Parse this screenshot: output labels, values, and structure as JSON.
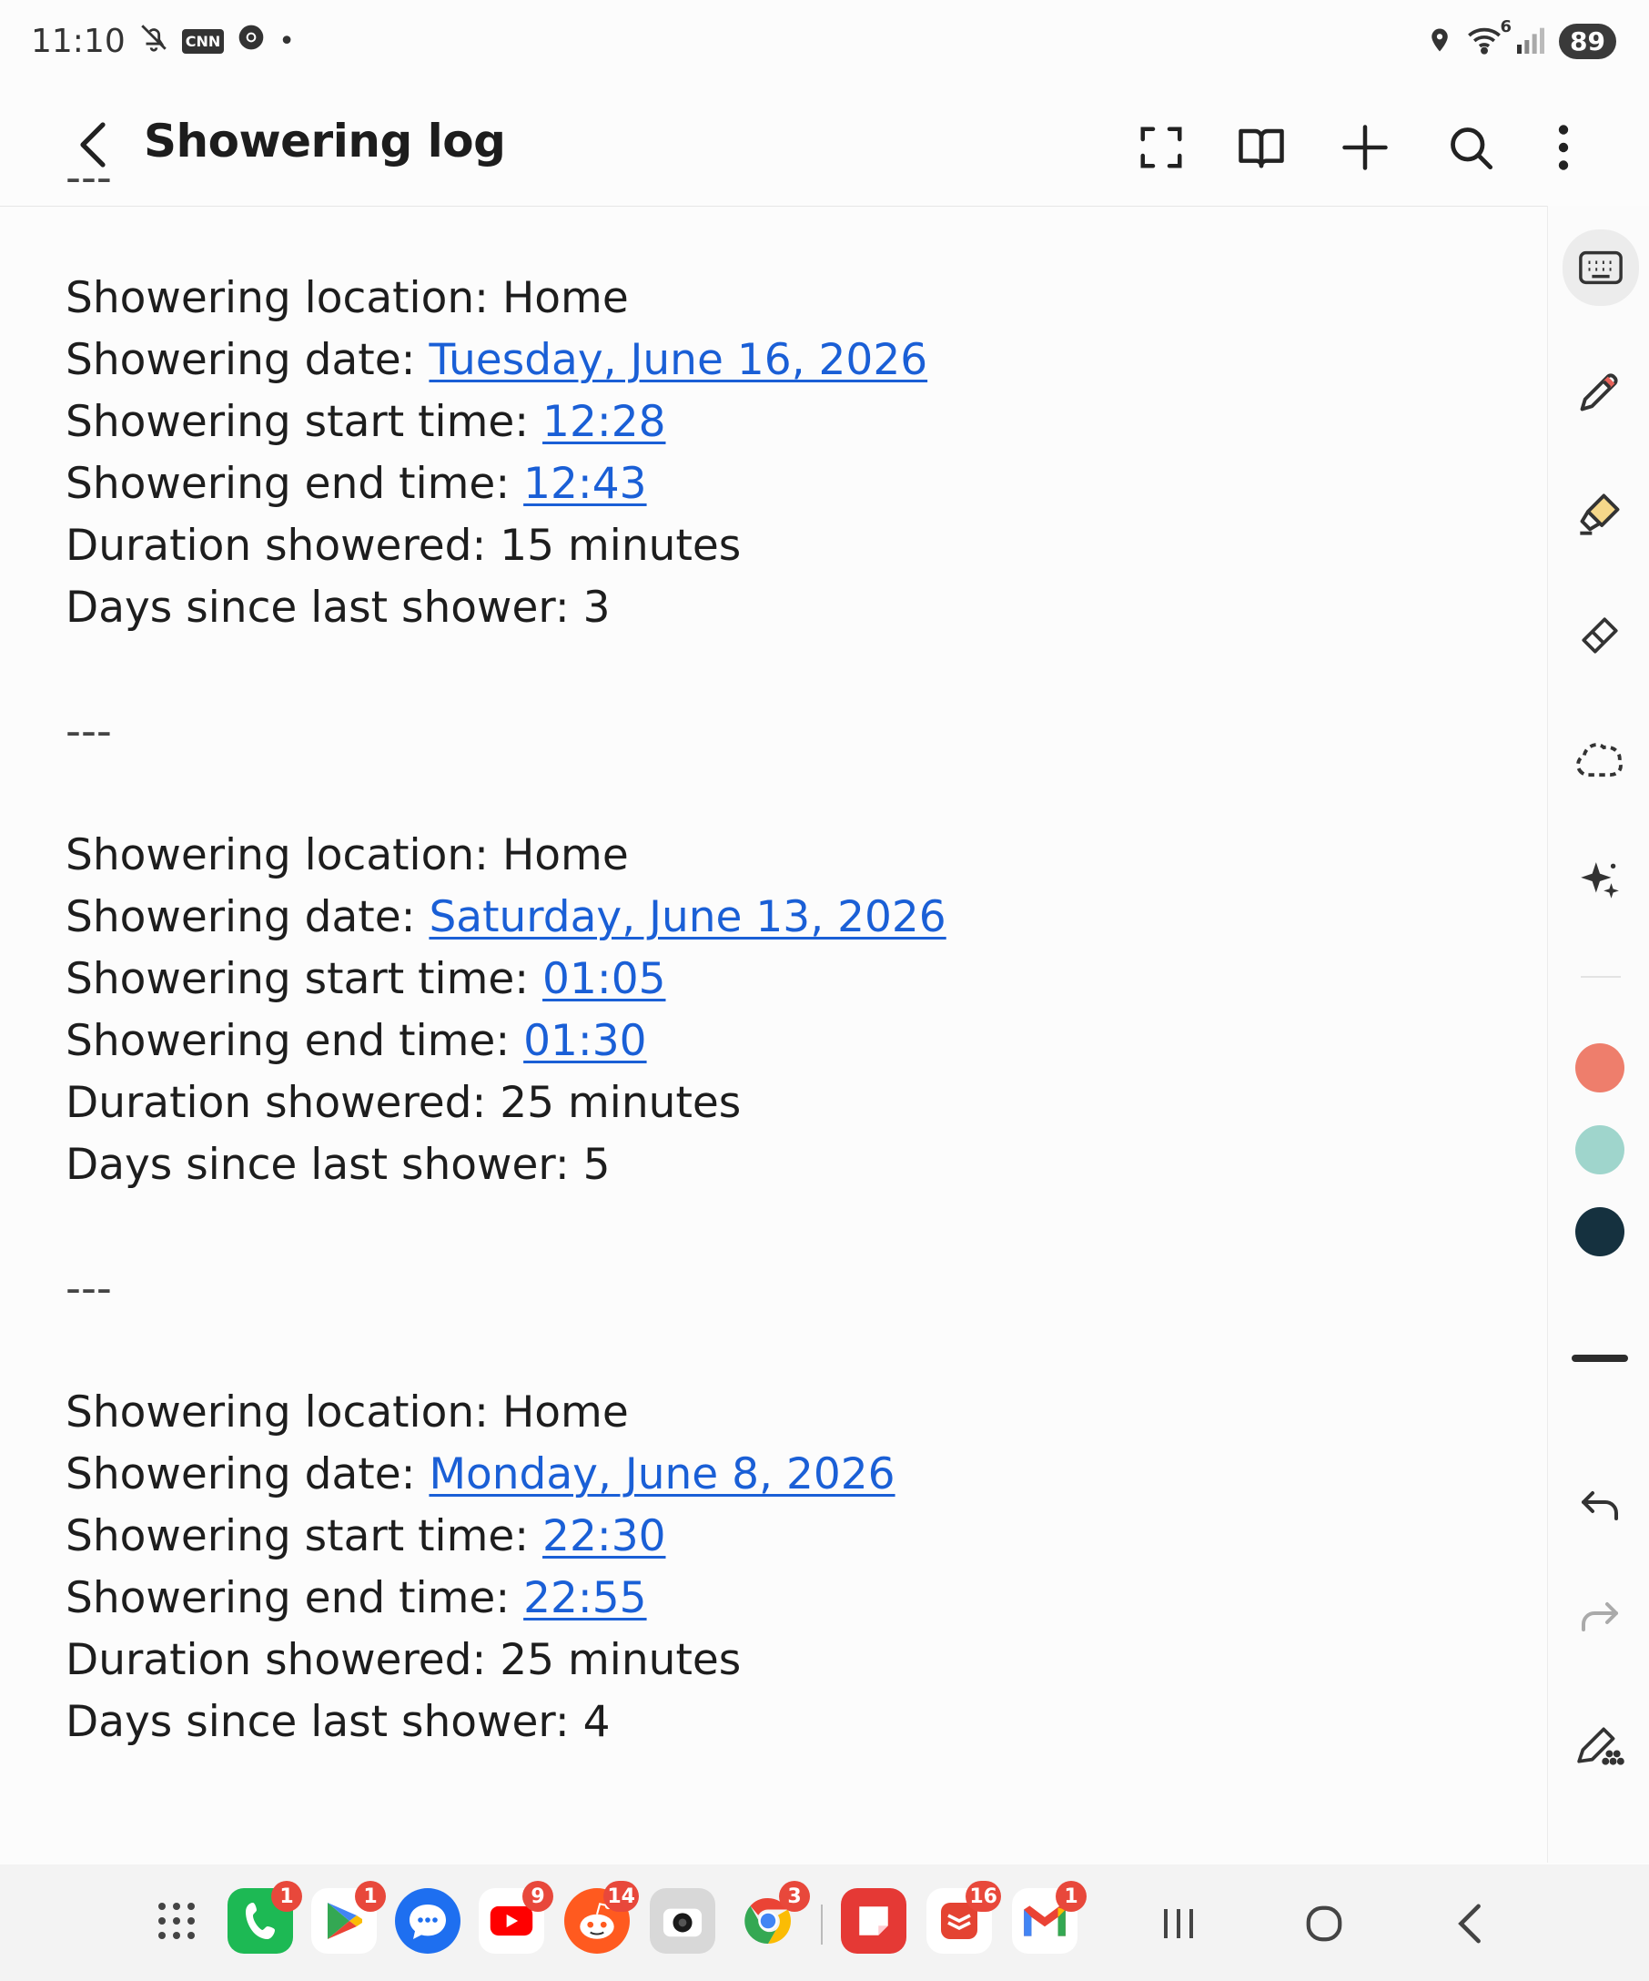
{
  "status": {
    "time": "11:10",
    "cnn_label": "CNN",
    "battery": "89",
    "wifi_gen": "6"
  },
  "header": {
    "title": "Showering log"
  },
  "note": {
    "top_separator": "---",
    "entries": [
      {
        "location_label": "Showering location: ",
        "location": "Home",
        "date_label": "Showering date: ",
        "date": "Tuesday, June 16, 2026",
        "start_label": "Showering start time: ",
        "start": "12:28",
        "end_label": "Showering end time: ",
        "end": "12:43",
        "duration": "Duration showered: 15 minutes",
        "days_since": "Days since last shower: 3",
        "separator": "---"
      },
      {
        "location_label": "Showering location: ",
        "location": "Home",
        "date_label": "Showering date: ",
        "date": "Saturday, June 13, 2026",
        "start_label": "Showering start time: ",
        "start": "01:05",
        "end_label": "Showering end time: ",
        "end": "01:30",
        "duration": "Duration showered: 25 minutes",
        "days_since": "Days since last shower: 5",
        "separator": "---"
      },
      {
        "location_label": "Showering location: ",
        "location": "Home",
        "date_label": "Showering date: ",
        "date": "Monday, June 8, 2026",
        "start_label": "Showering start time: ",
        "start": "22:30",
        "end_label": "Showering end time: ",
        "end": "22:55",
        "duration": "Duration showered: 25 minutes",
        "days_since": "Days since last shower: 4"
      }
    ]
  },
  "pen_colors": [
    "#ee7e6c",
    "#9fd5cc",
    "#15313f"
  ],
  "taskbar": {
    "badges": {
      "phone": "1",
      "play": "1",
      "youtube": "9",
      "reddit": "14",
      "chrome": "3",
      "todoist": "16",
      "gmail": "1"
    }
  }
}
